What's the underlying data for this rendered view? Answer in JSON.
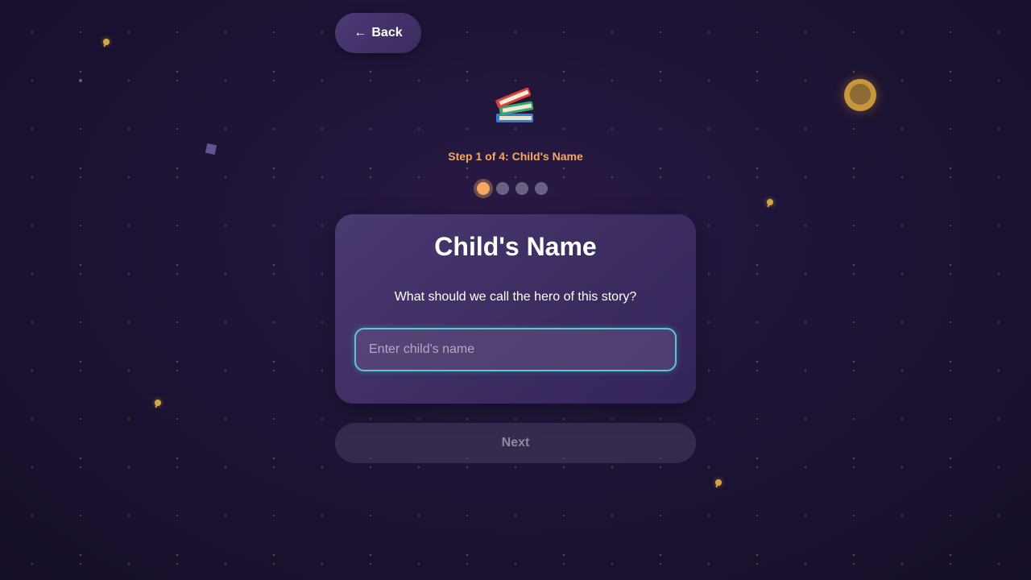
{
  "header": {
    "back_arrow": "←",
    "back_label": "Back"
  },
  "hero_icon": "books-icon",
  "progress": {
    "step_label": "Step 1 of 4: Child's Name",
    "current_step": 1,
    "total_steps": 4
  },
  "card": {
    "title": "Child's Name",
    "question": "What should we call the hero of this story?",
    "input": {
      "value": "",
      "placeholder": "Enter child's name"
    }
  },
  "footer": {
    "next_label": "Next",
    "next_enabled": false
  },
  "colors": {
    "accent": "#f4a860",
    "input_border": "#5cc8d4",
    "background": "#1e1436",
    "card": "#4a3a72"
  }
}
